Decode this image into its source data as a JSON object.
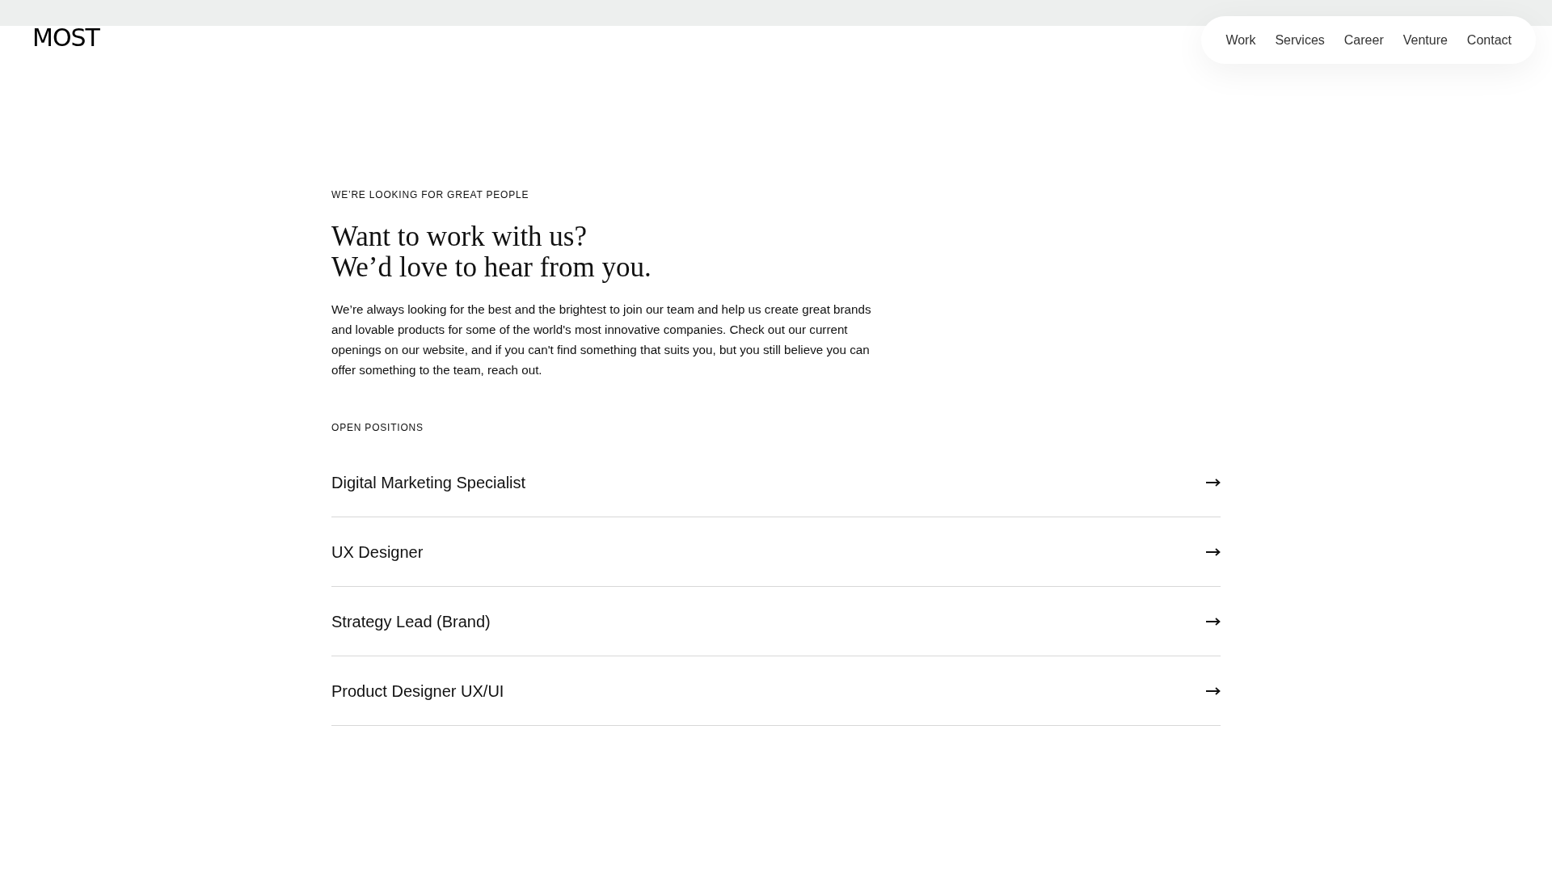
{
  "header": {
    "logo": "MOST",
    "nav": [
      {
        "label": "Work"
      },
      {
        "label": "Services"
      },
      {
        "label": "Career"
      },
      {
        "label": "Venture"
      },
      {
        "label": "Contact"
      }
    ]
  },
  "intro": {
    "eyebrow": "WE’RE LOOKING FOR GREAT PEOPLE",
    "heading": [
      "Want to work with us?",
      "We’d love to hear from you."
    ],
    "body": "We’re always looking for the best and the brightest to join our team and help us create great brands and lovable products for some of the world's most innovative companies. Check out our current openings on our website, and if you can't find something that suits you, but you still believe you can offer something to the team, reach out."
  },
  "positions": {
    "title": "OPEN POSITIONS",
    "items": [
      {
        "title": "Digital Marketing Specialist"
      },
      {
        "title": "UX Designer"
      },
      {
        "title": "Strategy Lead (Brand)"
      },
      {
        "title": "Product Designer UX/UI"
      }
    ]
  }
}
